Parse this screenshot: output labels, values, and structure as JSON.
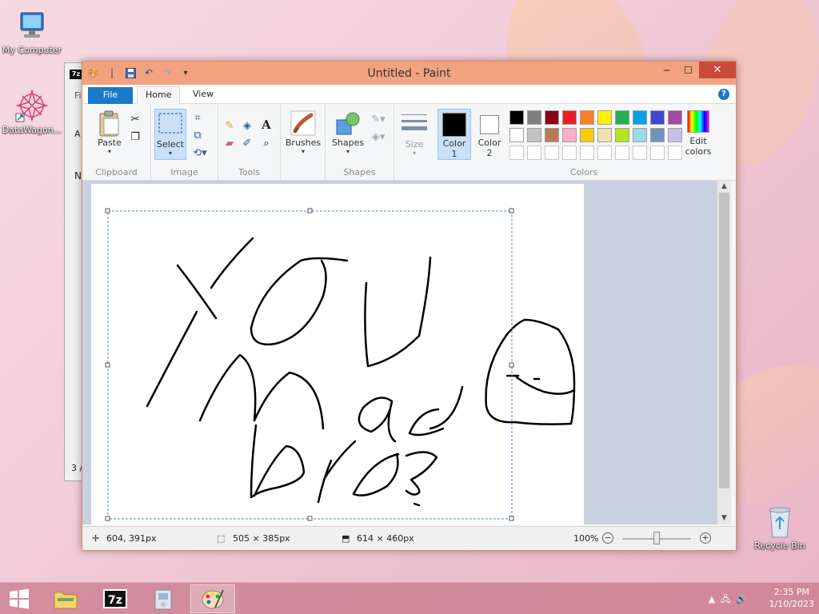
{
  "desktop": {
    "icons": [
      {
        "label": "My Computer"
      },
      {
        "label": "DataWagon..."
      },
      {
        "label": "Recycle Bin"
      }
    ]
  },
  "back_window": {
    "badge": "7z",
    "fragments": [
      "Fi",
      "N",
      "A",
      "3 /"
    ]
  },
  "paint": {
    "title": "Untitled - Paint",
    "tabs": {
      "file": "File",
      "home": "Home",
      "view": "View"
    },
    "help": "?",
    "ribbon": {
      "clipboard": {
        "paste": "Paste",
        "label": "Clipboard"
      },
      "image": {
        "select": "Select",
        "label": "Image"
      },
      "tools": {
        "label": "Tools",
        "text_tool": "A"
      },
      "brushes": {
        "label": "Brushes"
      },
      "shapes": {
        "label": "Shapes",
        "group_label": "Shapes"
      },
      "size": {
        "label": "Size"
      },
      "colors": {
        "color1": "Color",
        "color1_num": "1",
        "color2": "Color",
        "color2_num": "2",
        "edit_colors_line1": "Edit",
        "edit_colors_line2": "colors",
        "label": "Colors",
        "color1_value": "#000000",
        "color2_value": "#ffffff",
        "palette_row1": [
          "#000000",
          "#7f7f7f",
          "#880015",
          "#ed1c24",
          "#ff7f27",
          "#fff200",
          "#22b14c",
          "#00a2e8",
          "#3f48cc",
          "#a349a4"
        ],
        "palette_row2": [
          "#ffffff",
          "#c3c3c3",
          "#b97a57",
          "#ffaec9",
          "#ffc90e",
          "#efe4b0",
          "#b5e61d",
          "#99d9ea",
          "#7092be",
          "#c8bfe7"
        ]
      }
    },
    "status": {
      "cursor": "604, 391px",
      "selection": "505 × 385px",
      "canvas_size": "614 × 460px",
      "zoom": "100%",
      "zoom_value_percent": 100
    }
  },
  "taskbar": {
    "time": "2:35 PM",
    "date": "1/10/2023",
    "apps": [
      "start",
      "file-explorer",
      "7zip",
      "installer",
      "paint"
    ]
  }
}
